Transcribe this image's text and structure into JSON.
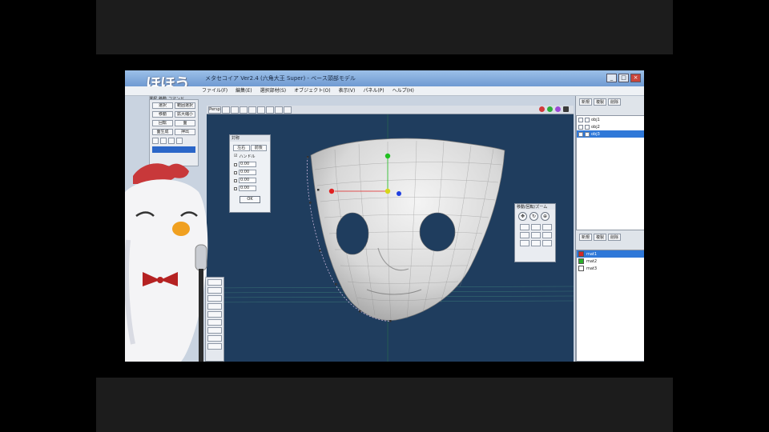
{
  "app": {
    "brand_logo_text": "ほほう",
    "window_title": "メタセコイア Ver2.4 (六角大王 Super) - ベース頭部モデル",
    "window_buttons": [
      "_",
      "□",
      "×"
    ]
  },
  "menu": [
    "ファイル(F)",
    "編集(E)",
    "選択部材(S)",
    "オブジェクト(O)",
    "表示(V)",
    "パネル(P)",
    "ヘルプ(H)"
  ],
  "left_panel": {
    "tabs": [
      "選択",
      "移動",
      "コマンド",
      "編集選択"
    ],
    "rows": [
      [
        "選択",
        "範囲選択"
      ],
      [
        "移動",
        "拡大縮小"
      ],
      [
        "回転",
        "面"
      ],
      [
        "面生成",
        "押出"
      ]
    ]
  },
  "viewport": {
    "toolbar_first": "Persp",
    "axis_colors": {
      "x": "#e02020",
      "y": "#20c020",
      "z": "#2040e0",
      "center": "#d6d61a"
    },
    "toolbar_dots": [
      "#d23a3a",
      "#2fae3a",
      "#9a4ad6",
      "#3a3a3a"
    ],
    "background": "#1f3d5e"
  },
  "mirror_dialog": {
    "title": "対称",
    "seg_left": "左右",
    "seg_right": "前後",
    "checkbox": "ハンドル",
    "fields": [
      "0.00",
      "0.00",
      "0.00",
      "0.00"
    ],
    "ok": "OK"
  },
  "nav_pad": {
    "title": "移動/回転/ズーム"
  },
  "right_panel": {
    "obj_tabs": [
      "新規",
      "複製",
      "削除"
    ],
    "objects": [
      {
        "name": "obj1",
        "selected": false
      },
      {
        "name": "obj2",
        "selected": false
      },
      {
        "name": "obj3",
        "selected": true
      }
    ],
    "mat_tabs": [
      "新規",
      "複製",
      "削除"
    ],
    "materials": [
      {
        "name": "mat1",
        "color": "#d22a2a",
        "selected": true
      },
      {
        "name": "mat2",
        "color": "#2ab02a",
        "selected": false
      },
      {
        "name": "mat3",
        "color": "#ffffff",
        "selected": false
      }
    ]
  }
}
